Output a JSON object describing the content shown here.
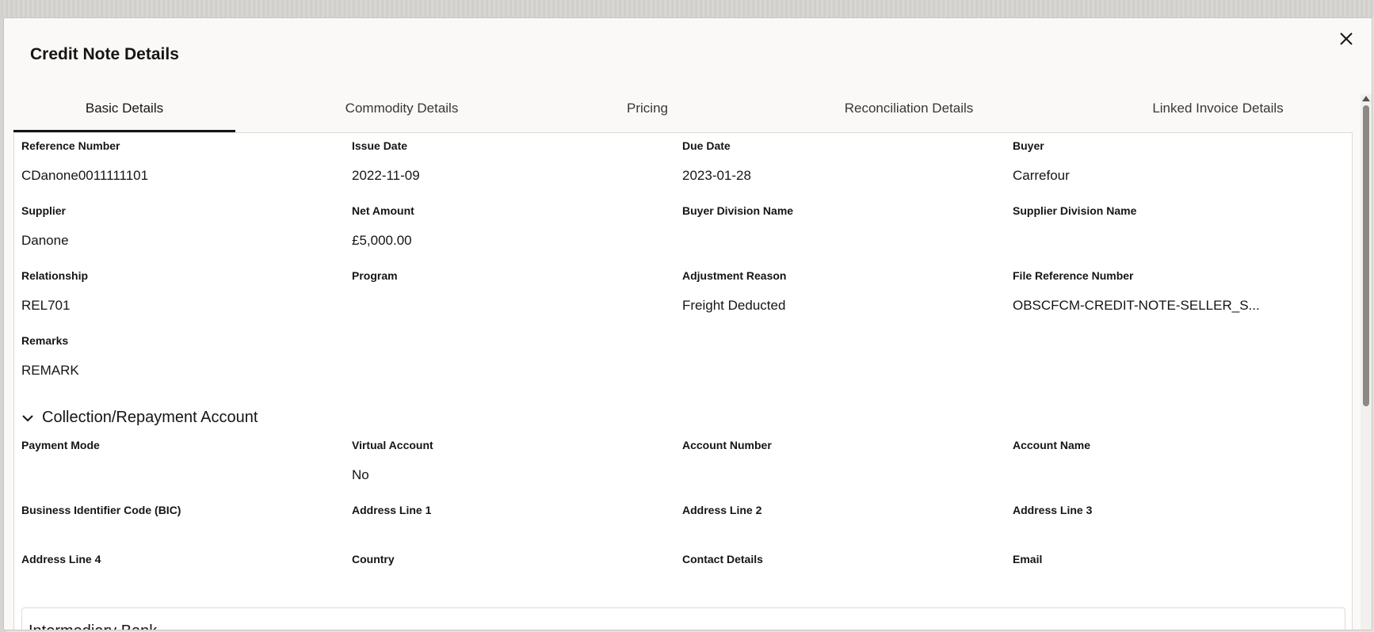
{
  "dialog": {
    "title": "Credit Note Details",
    "close_icon": "close-icon"
  },
  "tabs": [
    {
      "label": "Basic Details",
      "active": true
    },
    {
      "label": "Commodity Details",
      "active": false
    },
    {
      "label": "Pricing",
      "active": false
    },
    {
      "label": "Reconciliation Details",
      "active": false
    },
    {
      "label": "Linked Invoice Details",
      "active": false
    }
  ],
  "basic": {
    "reference_number": {
      "label": "Reference Number",
      "value": "CDanone0011111101"
    },
    "issue_date": {
      "label": "Issue Date",
      "value": "2022-11-09"
    },
    "due_date": {
      "label": "Due Date",
      "value": "2023-01-28"
    },
    "buyer": {
      "label": "Buyer",
      "value": "Carrefour"
    },
    "supplier": {
      "label": "Supplier",
      "value": "Danone"
    },
    "net_amount": {
      "label": "Net Amount",
      "value": "£5,000.00"
    },
    "buyer_division_name": {
      "label": "Buyer Division Name",
      "value": ""
    },
    "supplier_division_name": {
      "label": "Supplier Division Name",
      "value": ""
    },
    "relationship": {
      "label": "Relationship",
      "value": "REL701"
    },
    "program": {
      "label": "Program",
      "value": ""
    },
    "adjustment_reason": {
      "label": "Adjustment Reason",
      "value": "Freight Deducted"
    },
    "file_reference_number": {
      "label": "File Reference Number",
      "value": "OBSCFCM-CREDIT-NOTE-SELLER_S..."
    },
    "remarks": {
      "label": "Remarks",
      "value": "REMARK"
    }
  },
  "collection": {
    "title": "Collection/Repayment Account",
    "payment_mode": {
      "label": "Payment Mode",
      "value": ""
    },
    "virtual_account": {
      "label": "Virtual Account",
      "value": "No"
    },
    "account_number": {
      "label": "Account Number",
      "value": ""
    },
    "account_name": {
      "label": "Account Name",
      "value": ""
    },
    "bic": {
      "label": "Business Identifier Code (BIC)",
      "value": ""
    },
    "address_line_1": {
      "label": "Address Line 1",
      "value": ""
    },
    "address_line_2": {
      "label": "Address Line 2",
      "value": ""
    },
    "address_line_3": {
      "label": "Address Line 3",
      "value": ""
    },
    "address_line_4": {
      "label": "Address Line 4",
      "value": ""
    },
    "country": {
      "label": "Country",
      "value": ""
    },
    "contact_details": {
      "label": "Contact Details",
      "value": ""
    },
    "email": {
      "label": "Email",
      "value": ""
    }
  },
  "intermediary": {
    "title": "Intermediary Bank"
  }
}
